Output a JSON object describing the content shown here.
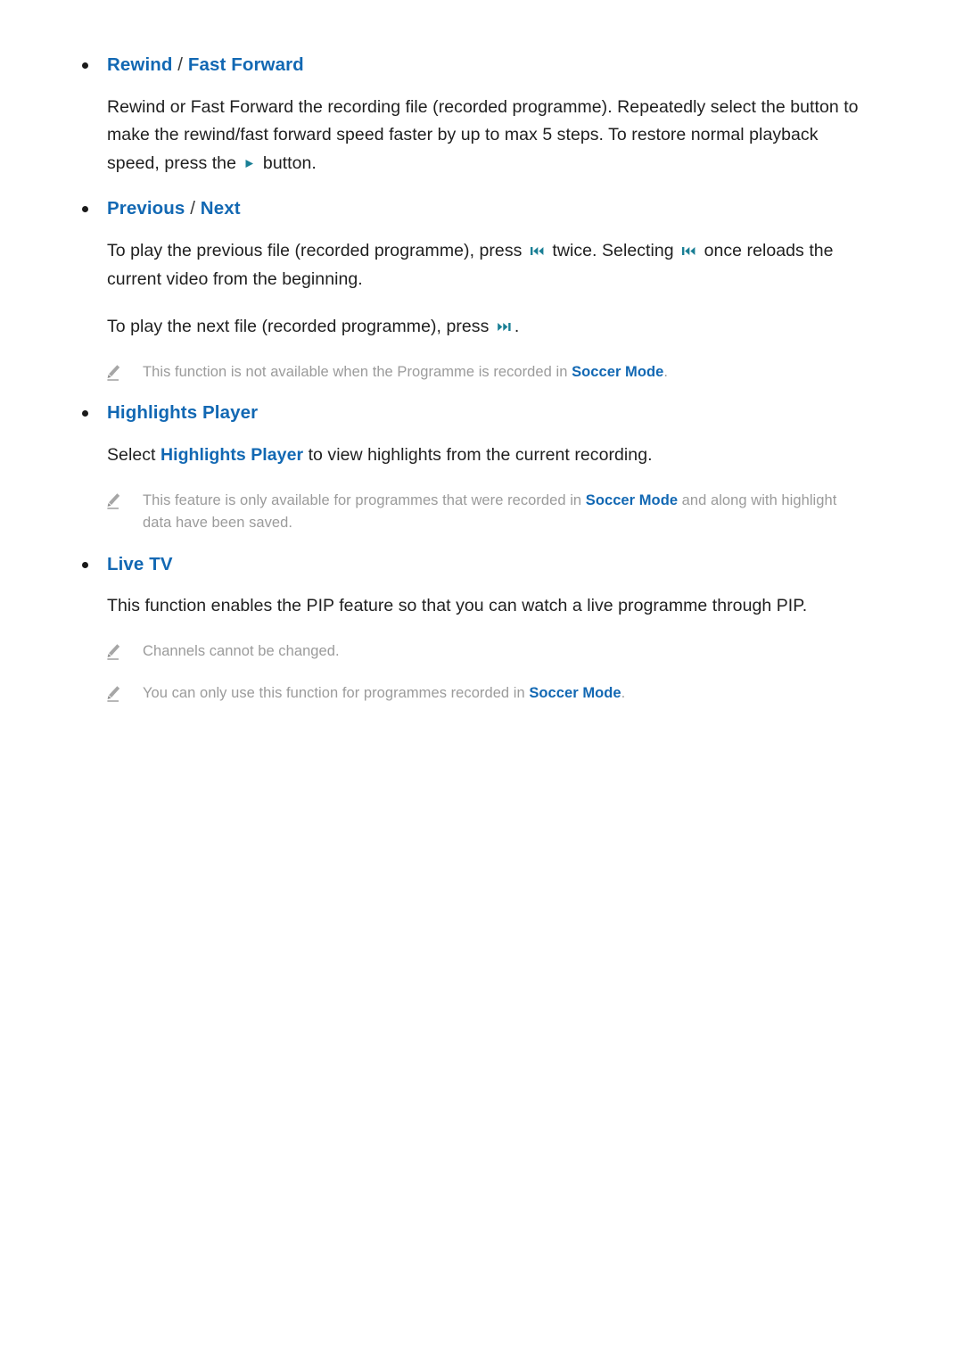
{
  "document": {
    "accent_blue": "#1268b3",
    "note_gray": "#9b9b9b",
    "glyph_teal": "#1a7f95",
    "sections": [
      {
        "id": "rewind-fast-forward",
        "heading_primary": "Rewind",
        "heading_separator": " / ",
        "heading_secondary": "Fast Forward",
        "body": {
          "part1": "Rewind or Fast Forward the recording file (recorded programme). Repeatedly select the button to make the rewind/fast forward speed faster by up to max 5 steps. To restore normal playback speed, press the ",
          "icon": "play-icon",
          "part2": " button."
        }
      },
      {
        "id": "previous-next",
        "heading_primary": "Previous",
        "heading_separator": " / ",
        "heading_secondary": "Next",
        "body1": {
          "part1": "To play the previous file (recorded programme), press ",
          "icon1": "skip-previous-icon",
          "part2": " twice. Selecting ",
          "icon2": "skip-previous-icon",
          "part3": " once reloads the current video from the beginning."
        },
        "body2": {
          "part1": "To play the next file (recorded programme), press ",
          "icon": "skip-next-icon",
          "part2": "."
        },
        "notes": [
          {
            "icon": "pencil-note-icon",
            "part1": "This function is not available when the Programme is recorded in ",
            "keyword": "Soccer Mode",
            "part2": "."
          }
        ]
      },
      {
        "id": "highlights-player",
        "heading_primary": "Highlights Player",
        "body": {
          "part1": "Select ",
          "keyword": "Highlights Player",
          "part2": " to view highlights from the current recording."
        },
        "notes": [
          {
            "icon": "pencil-note-icon",
            "part1": "This feature is only available for programmes that were recorded in ",
            "keyword": "Soccer Mode",
            "part2": " and along with highlight data have been saved."
          }
        ]
      },
      {
        "id": "live-tv",
        "heading_primary": "Live TV",
        "body": {
          "part1": "This function enables the PIP feature so that you can watch a live programme through PIP."
        },
        "notes": [
          {
            "icon": "pencil-note-icon",
            "part1": "Channels cannot be changed.",
            "keyword": "",
            "part2": ""
          },
          {
            "icon": "pencil-note-icon",
            "part1": "You can only use this function for programmes recorded in ",
            "keyword": "Soccer Mode",
            "part2": "."
          }
        ]
      }
    ]
  }
}
